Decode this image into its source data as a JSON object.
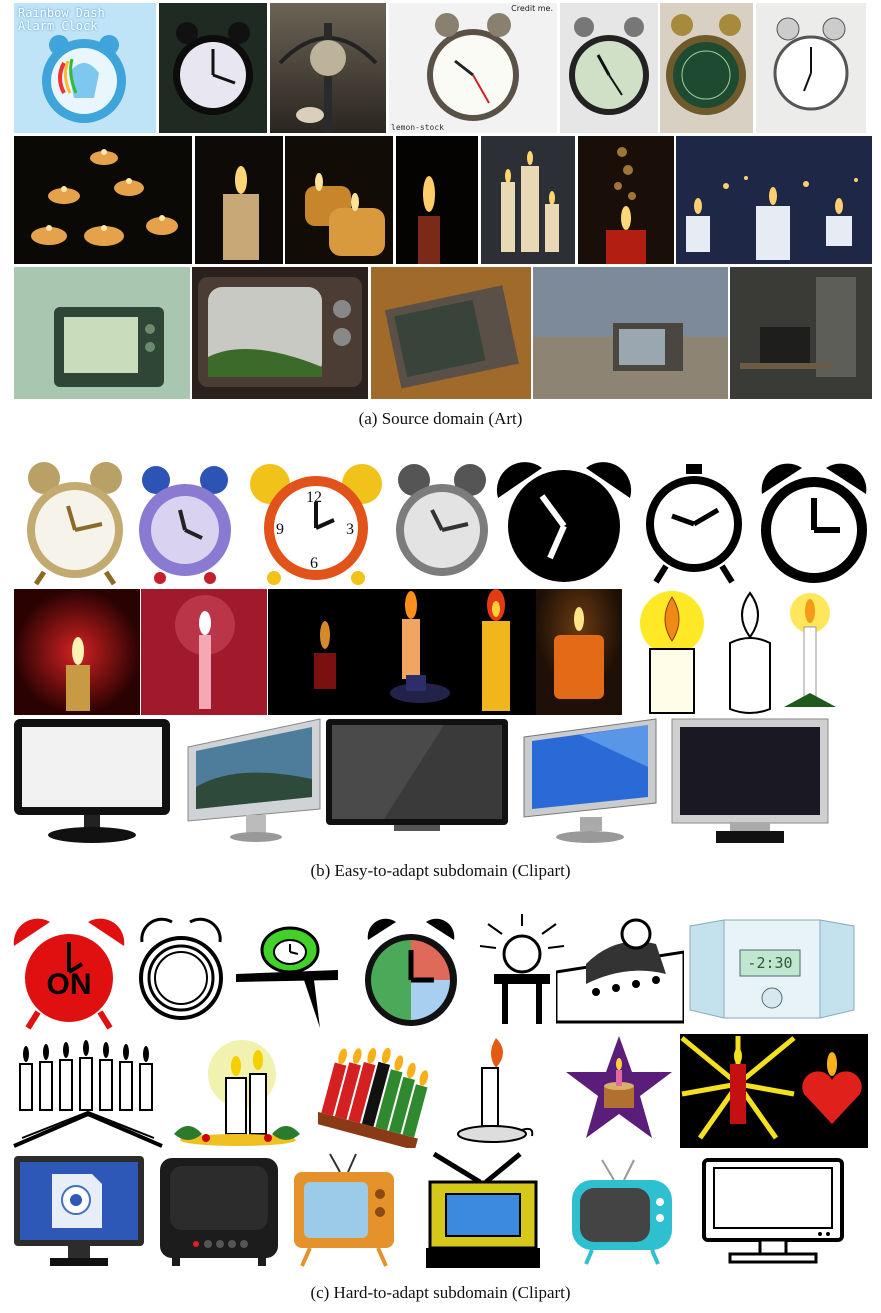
{
  "captions": {
    "art": "(a)  Source domain (Art)",
    "easy": "(b)  Easy-to-adapt subdomain (Clipart)",
    "hard": "(c)  Hard-to-adapt subdomain (Clipart)"
  },
  "overlay_text": {
    "rainbow_title_1": "Rainbow Dash",
    "rainbow_title_2": "Alarm Clock",
    "credit": "Credit me.",
    "lemon_stock": "lemon-stock",
    "on_label": "ON",
    "digital_time": "-2:30"
  },
  "panels": {
    "art": {
      "rows": [
        "alarm-clocks",
        "candles",
        "televisions"
      ]
    },
    "easy": {
      "rows": [
        "alarm-clocks",
        "candles",
        "monitors"
      ]
    },
    "hard": {
      "rows": [
        "alarm-clocks",
        "candles",
        "televisions"
      ]
    }
  }
}
